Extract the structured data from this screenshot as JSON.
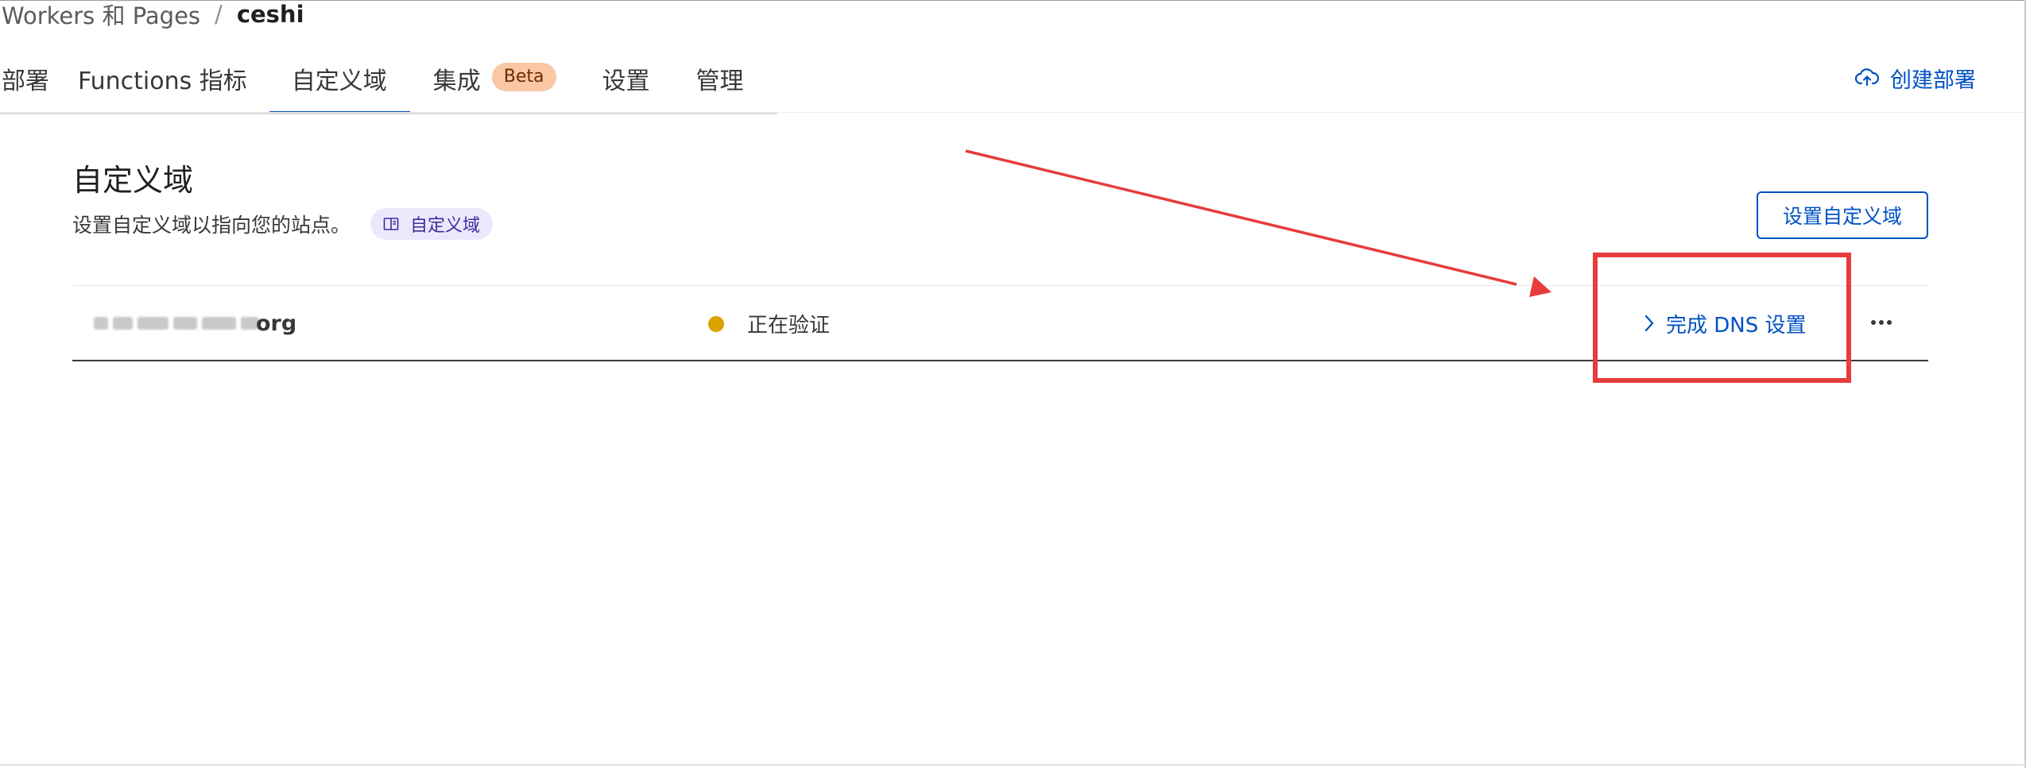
{
  "breadcrumb": {
    "parent": "Workers 和 Pages",
    "separator": "/",
    "current": "ceshi"
  },
  "tabs": [
    {
      "label": "部署",
      "active": false
    },
    {
      "label": "Functions 指标",
      "active": false
    },
    {
      "label": "自定义域",
      "active": true
    },
    {
      "label": "集成",
      "active": false,
      "badge": "Beta"
    },
    {
      "label": "设置",
      "active": false
    },
    {
      "label": "管理",
      "active": false
    }
  ],
  "header_actions": {
    "create_deploy_label": "创建部署",
    "create_deploy_icon": "cloud-upload-icon"
  },
  "section": {
    "title": "自定义域",
    "description": "设置自定义域以指向您的站点。",
    "doc_link_label": "自定义域",
    "doc_link_icon": "book-icon",
    "setup_button_label": "设置自定义域"
  },
  "domains": [
    {
      "name_visible_suffix": "org",
      "name_obscured": true,
      "status": "正在验证",
      "status_color": "#d9a300",
      "action_label": "完成 DNS 设置",
      "action_icon": "chevron-right-icon",
      "more_icon": "more-horizontal-icon"
    }
  ],
  "colors": {
    "accent": "#0051c3",
    "annotation": "#e63c3c",
    "beta_badge_bg": "#f9c7a3",
    "doc_chip_bg": "#ece8fb"
  }
}
